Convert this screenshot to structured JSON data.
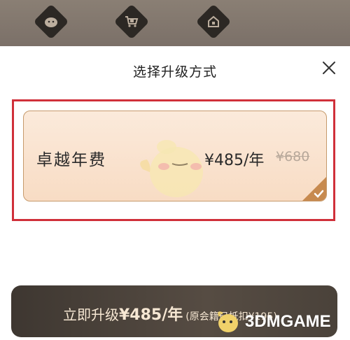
{
  "background_icons": [
    {
      "icon": "face-icon"
    },
    {
      "icon": "shopping-cart-icon"
    },
    {
      "icon": "home-icon"
    }
  ],
  "dialog": {
    "title": "选择升级方式",
    "close_icon": "close-icon"
  },
  "plan": {
    "name": "卓越年费",
    "price": "¥485/年",
    "original_price": "¥680",
    "selected": true
  },
  "upgrade_button": {
    "label": "立即升级",
    "amount": "¥485/年",
    "note": "(原会籍已抵扣¥195)"
  },
  "watermark": {
    "text": "3DMGAME"
  },
  "colors": {
    "accent_border": "#c69a6c",
    "card_fill": "#f8dcc4",
    "highlight_red": "#d0303a",
    "button_dark": "#4a423a",
    "button_text": "#f6e7d3"
  }
}
